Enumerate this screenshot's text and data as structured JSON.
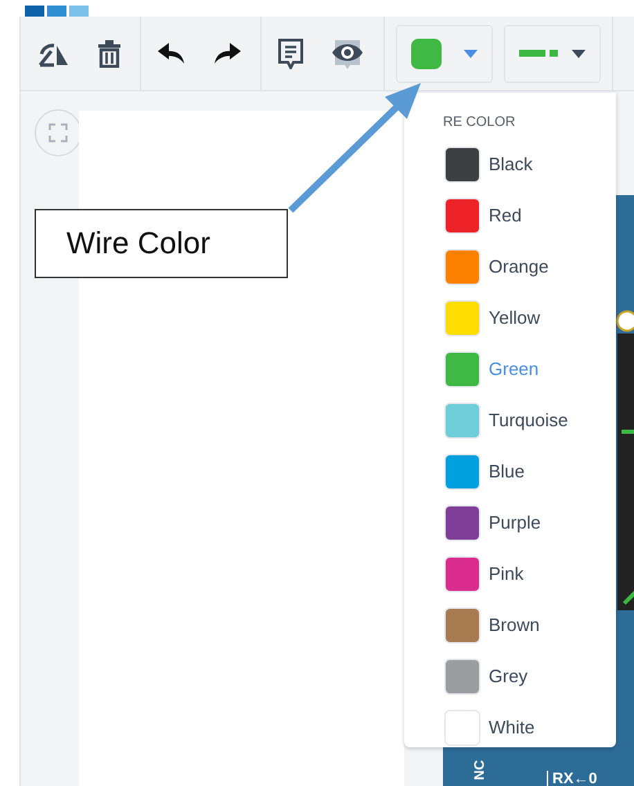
{
  "toolbar": {
    "line_style_button": {
      "color": "#3db843"
    }
  },
  "color_menu": {
    "header": "RE COLOR",
    "items": [
      {
        "name": "Black",
        "color": "#3c4043",
        "selected": false
      },
      {
        "name": "Red",
        "color": "#ee2229",
        "selected": false
      },
      {
        "name": "Orange",
        "color": "#fb8200",
        "selected": false
      },
      {
        "name": "Yellow",
        "color": "#ffdd00",
        "selected": false
      },
      {
        "name": "Green",
        "color": "#3fb943",
        "selected": true
      },
      {
        "name": "Turquoise",
        "color": "#70cedb",
        "selected": false
      },
      {
        "name": "Blue",
        "color": "#009fdd",
        "selected": false
      },
      {
        "name": "Purple",
        "color": "#7f3f98",
        "selected": false
      },
      {
        "name": "Pink",
        "color": "#da2c8c",
        "selected": false
      },
      {
        "name": "Brown",
        "color": "#a97b50",
        "selected": false
      },
      {
        "name": "Grey",
        "color": "#9a9ea1",
        "selected": false
      },
      {
        "name": "White",
        "color": "#ffffff",
        "selected": false
      }
    ]
  },
  "callout": {
    "text": "Wire Color"
  },
  "board": {
    "labels": [
      "NC",
      "RX←0"
    ]
  }
}
